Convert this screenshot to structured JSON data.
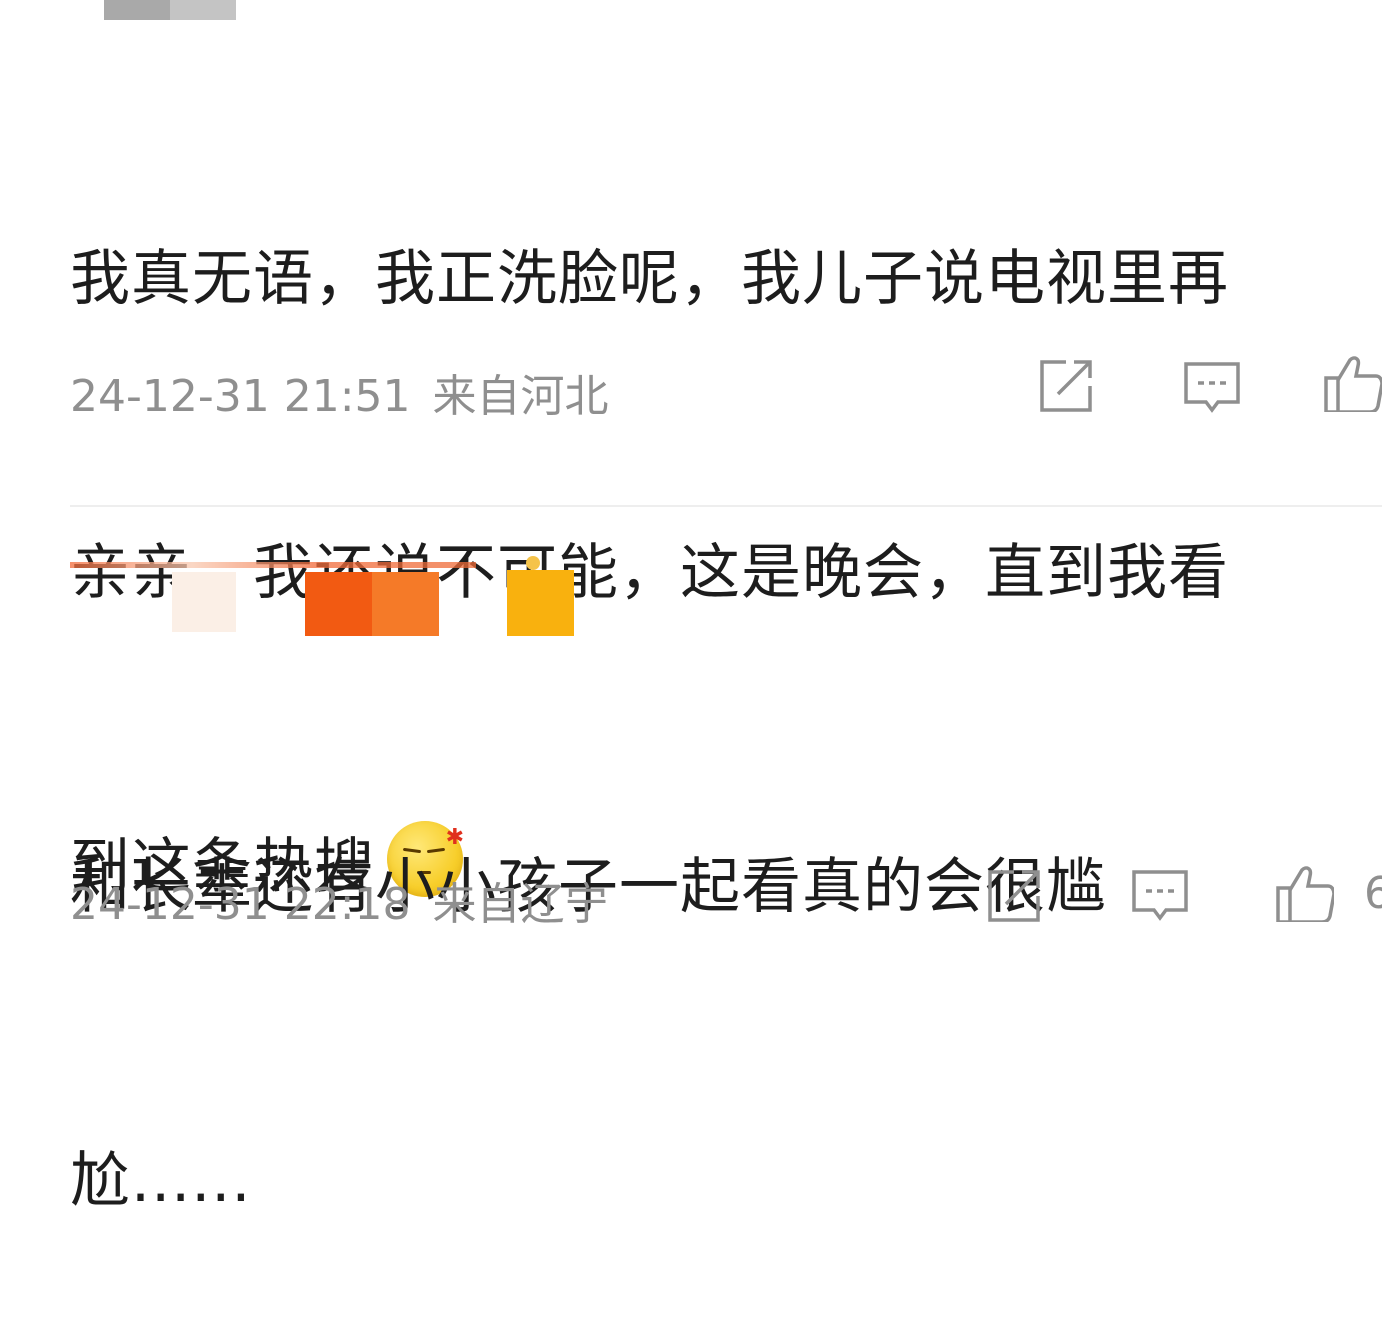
{
  "comments": [
    {
      "text_lines": [
        "我真无语，我正洗脸呢，我儿子说电视里再",
        "亲亲，我还说不可能，这是晚会，直到我看",
        "到这条热搜"
      ],
      "emoji": "annoyed-face-emoji",
      "timestamp": "24-12-31 21:51",
      "location": "来自河北"
    },
    {
      "text_lines": [
        "和长辈还有小小孩子一起看真的会很尴",
        "尬......"
      ],
      "timestamp": "24-12-31 22:18",
      "location": "来自辽宁",
      "like_count_partial": "6"
    }
  ],
  "icons": {
    "share": "share-icon",
    "comment": "comment-icon",
    "like": "thumbs-up-icon"
  },
  "colors": {
    "meta_text": "#8f8f8f",
    "icon_stroke": "#8f8f8f",
    "body_text": "#1d1d1d"
  }
}
